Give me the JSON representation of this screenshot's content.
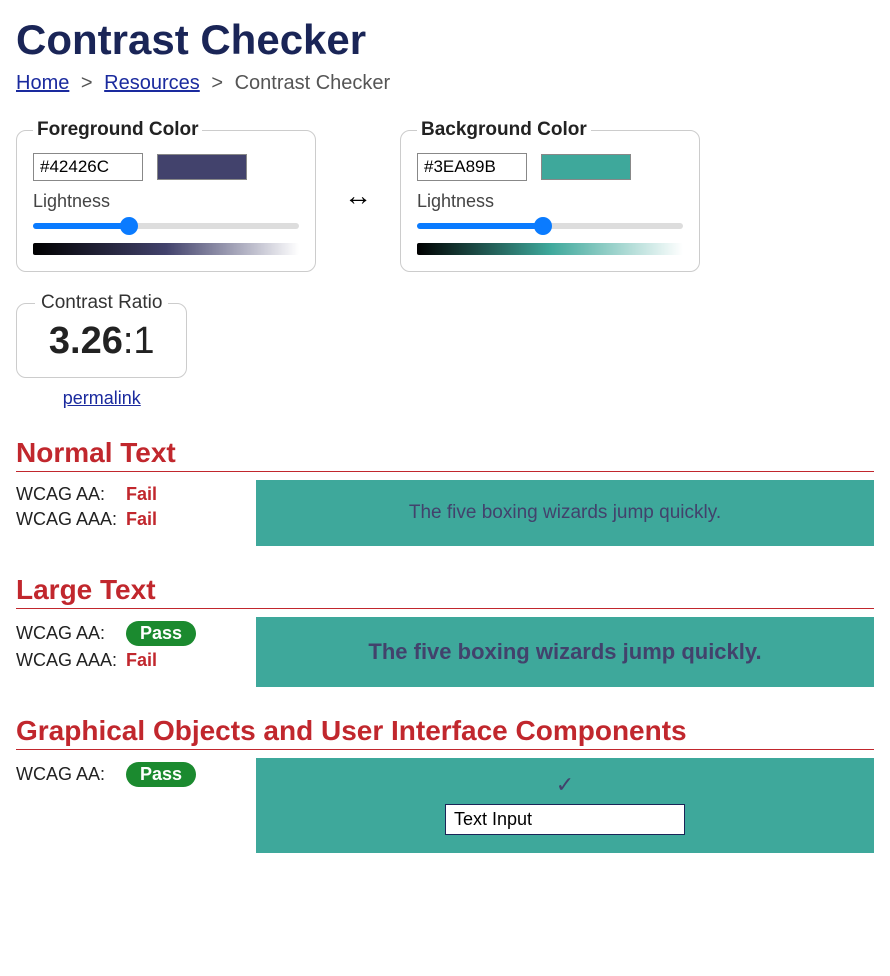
{
  "title": "Contrast Checker",
  "breadcrumb": {
    "home": "Home",
    "resources": "Resources",
    "current": "Contrast Checker"
  },
  "foreground": {
    "legend": "Foreground Color",
    "hex": "#42426C",
    "lightness_label": "Lightness",
    "lightness_value": 35
  },
  "background": {
    "legend": "Background Color",
    "hex": "#3EA89B",
    "lightness_label": "Lightness",
    "lightness_value": 47
  },
  "ratio": {
    "legend": "Contrast Ratio",
    "value": "3.26",
    "suffix": ":1",
    "permalink": "permalink"
  },
  "sample_text": "The five boxing wizards jump quickly.",
  "normal_text": {
    "heading": "Normal Text",
    "aa_label": "WCAG AA:",
    "aa_result": "Fail",
    "aa_pass": false,
    "aaa_label": "WCAG AAA:",
    "aaa_result": "Fail",
    "aaa_pass": false
  },
  "large_text": {
    "heading": "Large Text",
    "aa_label": "WCAG AA:",
    "aa_result": "Pass",
    "aa_pass": true,
    "aaa_label": "WCAG AAA:",
    "aaa_result": "Fail",
    "aaa_pass": false
  },
  "gui": {
    "heading": "Graphical Objects and User Interface Components",
    "aa_label": "WCAG AA:",
    "aa_result": "Pass",
    "aa_pass": true,
    "input_value": "Text Input"
  }
}
